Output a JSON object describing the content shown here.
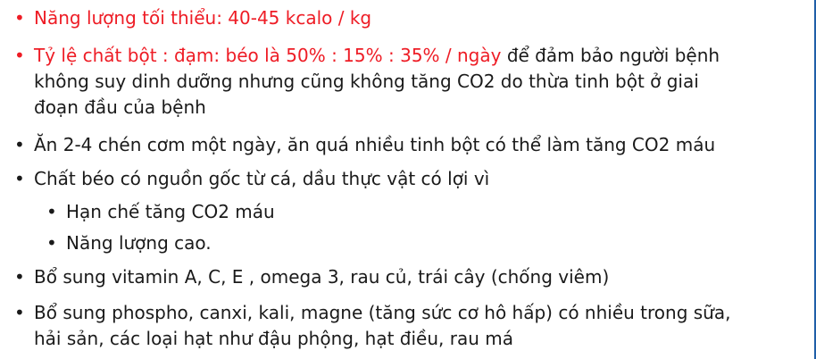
{
  "colors": {
    "highlight": "#ee1c25",
    "text": "#1a1a1a",
    "edge_line": "#1f5fa8"
  },
  "bullet_symbol": "•",
  "bullets": [
    {
      "text": "Năng lượng tối thiểu: 40-45 kcalo / kg"
    },
    {
      "red_text": "Tỷ lệ chất bột : đạm: béo là 50% : 15% : 35% / ngày",
      "text_line1": " để đảm bảo người bệnh",
      "text_line2": "không suy dinh dưỡng nhưng cũng không tăng CO2 do thừa tinh bột ở giai",
      "text_line3": "đoạn đầu của bệnh"
    },
    {
      "text": "Ăn 2-4 chén cơm một ngày, ăn quá nhiều tinh bột có thể làm tăng CO2 máu"
    },
    {
      "text": "Chất béo có nguồn gốc từ cá, dầu thực vật có lợi vì",
      "sub": [
        "Hạn chế tăng CO2 máu",
        "Năng lượng cao."
      ]
    },
    {
      "text": "Bổ sung vitamin A, C, E , omega 3, rau củ, trái cây (chống viêm)"
    },
    {
      "text_line1": "Bổ sung phospho, canxi, kali, magne (tăng sức cơ hô hấp) có nhiều trong sữa,",
      "text_line2": "hải sản, các loại hạt như đậu phộng, hạt điều, rau má"
    }
  ]
}
